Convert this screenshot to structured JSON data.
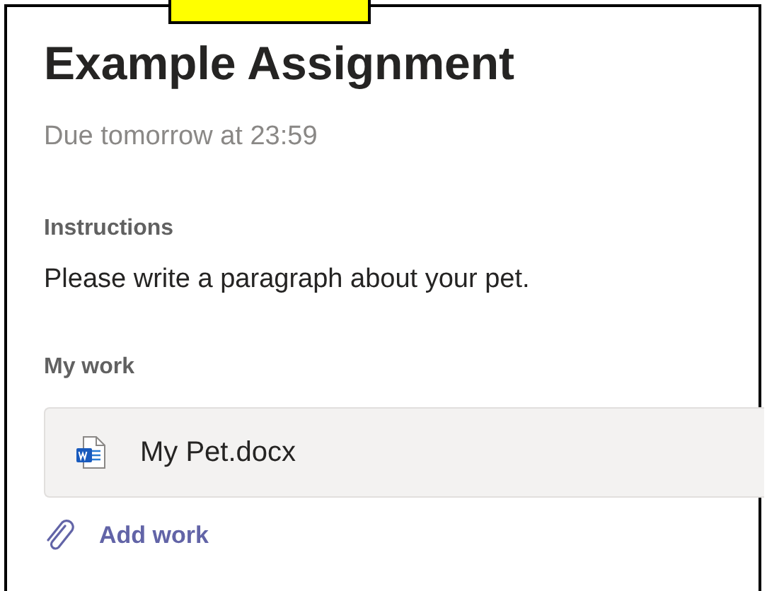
{
  "title": "Example Assignment",
  "due": "Due tomorrow at 23:59",
  "instructions": {
    "label": "Instructions",
    "text": "Please write a paragraph about your pet."
  },
  "my_work": {
    "label": "My work",
    "files": [
      {
        "name": "My Pet.docx",
        "kind": "word"
      }
    ],
    "add_button": "Add work"
  }
}
